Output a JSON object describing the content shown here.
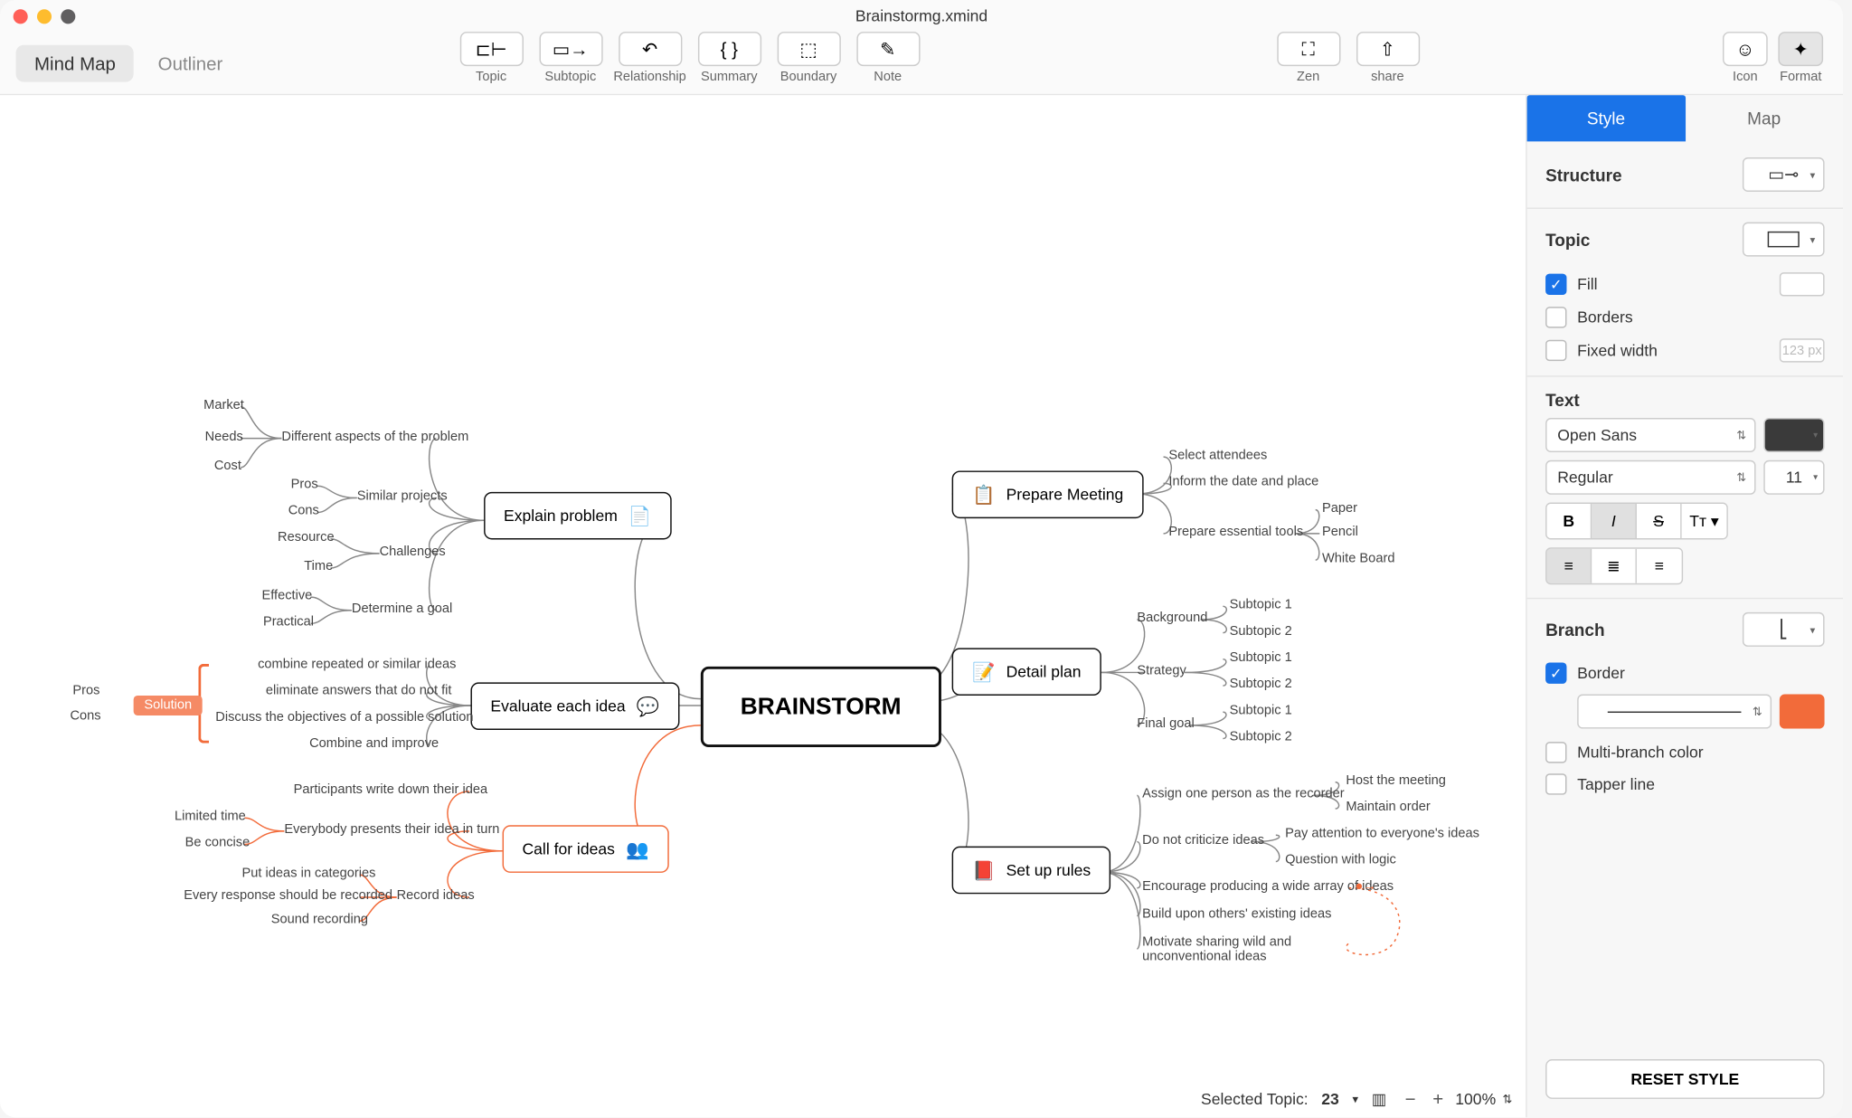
{
  "title": "Brainstormg.xmind",
  "viewTabs": {
    "mindmap": "Mind Map",
    "outliner": "Outliner"
  },
  "toolbar": {
    "topic": "Topic",
    "subtopic": "Subtopic",
    "relationship": "Relationship",
    "summary": "Summary",
    "boundary": "Boundary",
    "note": "Note",
    "zen": "Zen",
    "share": "share",
    "icon": "Icon",
    "format": "Format"
  },
  "panel": {
    "tabs": {
      "style": "Style",
      "map": "Map"
    },
    "structure": "Structure",
    "topic": "Topic",
    "fill": "Fill",
    "borders": "Borders",
    "fixedwidth": "Fixed width",
    "fixedwidthVal": "123 px",
    "text": "Text",
    "font": "Open Sans",
    "weight": "Regular",
    "size": "11",
    "branch": "Branch",
    "border": "Border",
    "multibranch": "Multi-branch color",
    "tapper": "Tapper line",
    "reset": "RESET STYLE"
  },
  "status": {
    "selectedLabel": "Selected Topic:",
    "selectedCount": "23",
    "zoom": "100%"
  },
  "map": {
    "central": "BRAINSTORM",
    "left": {
      "explain": "Explain problem",
      "evaluate": "Evaluate each idea",
      "call": "Call for ideas",
      "solution": "Solution",
      "pros": "Pros",
      "cons": "Cons",
      "explainSubs": {
        "aspects": "Different aspects of the problem",
        "aspectsSub": [
          "Market",
          "Needs",
          "Cost"
        ],
        "similar": "Similar projects",
        "similarSub": [
          "Pros",
          "Cons"
        ],
        "challenges": "Challenges",
        "challengesSub": [
          "Resource",
          "Time"
        ],
        "goal": "Determine a goal",
        "goalSub": [
          "Effective",
          "Practical"
        ]
      },
      "evalSubs": [
        "combine repeated or similar ideas",
        "eliminate answers that do not fit",
        "Discuss the objectives of a possible solution",
        "Combine and improve"
      ],
      "callSubs": {
        "write": "Participants write down their idea",
        "present": "Everybody presents their idea in turn",
        "presentSub": [
          "Limited time",
          "Be concise"
        ],
        "record": "Record ideas",
        "recordSub": [
          "Put ideas in categories",
          "Every response should be recorded",
          "Sound recording"
        ]
      }
    },
    "right": {
      "prepare": "Prepare Meeting",
      "detail": "Detail plan",
      "rules": "Set up rules",
      "prepareSubs": {
        "attendees": "Select attendees",
        "inform": "Inform the date and place",
        "tools": "Prepare essential tools",
        "toolsSub": [
          "Paper",
          "Pencil",
          "White Board"
        ]
      },
      "detailSubs": {
        "background": "Background",
        "strategy": "Strategy",
        "finalgoal": "Final goal",
        "sub1": "Subtopic 1",
        "sub2": "Subtopic 2"
      },
      "rulesSubs": {
        "assign": "Assign one person as the recorder",
        "assignSub": [
          "Host the meeting",
          "Maintain order"
        ],
        "criticize": "Do not criticize ideas",
        "criticizeSub": [
          "Pay attention to everyone's ideas",
          "Question with logic"
        ],
        "encourage": "Encourage producing a wide array of ideas",
        "build": "Build upon others' existing ideas",
        "motivate": "Motivate sharing wild and unconventional ideas"
      }
    }
  },
  "colors": {
    "accent": "#1a73e8",
    "orange": "#f26b3a",
    "textSwatch": "#3a3a3a",
    "borderSwatch": "#f26b3a"
  }
}
